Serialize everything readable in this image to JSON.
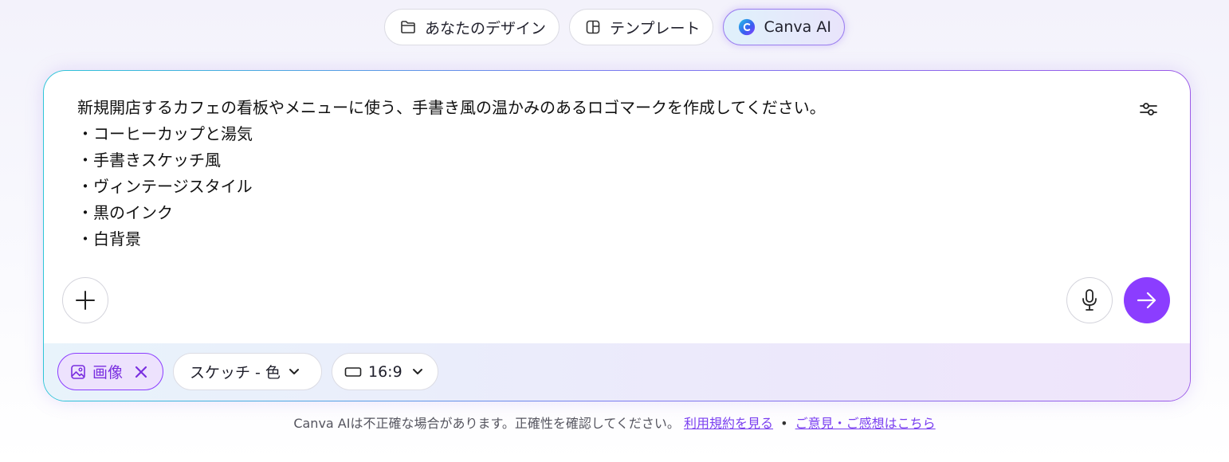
{
  "tabs": [
    {
      "label": "あなたのデザイン",
      "icon": "folder-icon"
    },
    {
      "label": "テンプレート",
      "icon": "template-icon"
    },
    {
      "label": "Canva AI",
      "icon": "canva-ai-icon",
      "active": true
    }
  ],
  "prompt": {
    "lines": [
      "新規開店するカフェの看板やメニューに使う、手書き風の温かみのあるロゴマークを作成してください。",
      "・コーヒーカップと湯気",
      "・手書きスケッチ風",
      "・ヴィンテージスタイル",
      "・黒のインク",
      "・白背景"
    ]
  },
  "options": {
    "type_label": "画像",
    "style_label": "スケッチ - 色",
    "ratio_label": "16:9"
  },
  "footer": {
    "disclaimer": "Canva AIは不正確な場合があります。正確性を確認してください。",
    "terms_link": "利用規約を見る",
    "separator": "•",
    "feedback_link": "ご意見・ご感想はこちら"
  },
  "colors": {
    "accent": "#8b3dff",
    "chip_active_bg": "#ede2fd",
    "link": "#7a3ff0"
  }
}
